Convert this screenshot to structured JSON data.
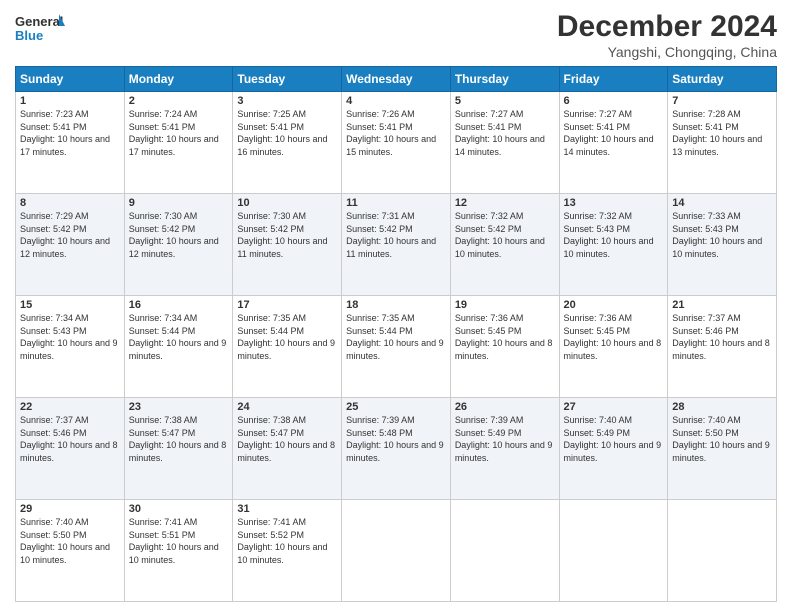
{
  "header": {
    "logo_line1": "General",
    "logo_line2": "Blue",
    "title": "December 2024",
    "subtitle": "Yangshi, Chongqing, China"
  },
  "columns": [
    "Sunday",
    "Monday",
    "Tuesday",
    "Wednesday",
    "Thursday",
    "Friday",
    "Saturday"
  ],
  "weeks": [
    [
      {
        "day": "1",
        "sunrise": "7:23 AM",
        "sunset": "5:41 PM",
        "daylight": "10 hours and 17 minutes."
      },
      {
        "day": "2",
        "sunrise": "7:24 AM",
        "sunset": "5:41 PM",
        "daylight": "10 hours and 17 minutes."
      },
      {
        "day": "3",
        "sunrise": "7:25 AM",
        "sunset": "5:41 PM",
        "daylight": "10 hours and 16 minutes."
      },
      {
        "day": "4",
        "sunrise": "7:26 AM",
        "sunset": "5:41 PM",
        "daylight": "10 hours and 15 minutes."
      },
      {
        "day": "5",
        "sunrise": "7:27 AM",
        "sunset": "5:41 PM",
        "daylight": "10 hours and 14 minutes."
      },
      {
        "day": "6",
        "sunrise": "7:27 AM",
        "sunset": "5:41 PM",
        "daylight": "10 hours and 14 minutes."
      },
      {
        "day": "7",
        "sunrise": "7:28 AM",
        "sunset": "5:41 PM",
        "daylight": "10 hours and 13 minutes."
      }
    ],
    [
      {
        "day": "8",
        "sunrise": "7:29 AM",
        "sunset": "5:42 PM",
        "daylight": "10 hours and 12 minutes."
      },
      {
        "day": "9",
        "sunrise": "7:30 AM",
        "sunset": "5:42 PM",
        "daylight": "10 hours and 12 minutes."
      },
      {
        "day": "10",
        "sunrise": "7:30 AM",
        "sunset": "5:42 PM",
        "daylight": "10 hours and 11 minutes."
      },
      {
        "day": "11",
        "sunrise": "7:31 AM",
        "sunset": "5:42 PM",
        "daylight": "10 hours and 11 minutes."
      },
      {
        "day": "12",
        "sunrise": "7:32 AM",
        "sunset": "5:42 PM",
        "daylight": "10 hours and 10 minutes."
      },
      {
        "day": "13",
        "sunrise": "7:32 AM",
        "sunset": "5:43 PM",
        "daylight": "10 hours and 10 minutes."
      },
      {
        "day": "14",
        "sunrise": "7:33 AM",
        "sunset": "5:43 PM",
        "daylight": "10 hours and 10 minutes."
      }
    ],
    [
      {
        "day": "15",
        "sunrise": "7:34 AM",
        "sunset": "5:43 PM",
        "daylight": "10 hours and 9 minutes."
      },
      {
        "day": "16",
        "sunrise": "7:34 AM",
        "sunset": "5:44 PM",
        "daylight": "10 hours and 9 minutes."
      },
      {
        "day": "17",
        "sunrise": "7:35 AM",
        "sunset": "5:44 PM",
        "daylight": "10 hours and 9 minutes."
      },
      {
        "day": "18",
        "sunrise": "7:35 AM",
        "sunset": "5:44 PM",
        "daylight": "10 hours and 9 minutes."
      },
      {
        "day": "19",
        "sunrise": "7:36 AM",
        "sunset": "5:45 PM",
        "daylight": "10 hours and 8 minutes."
      },
      {
        "day": "20",
        "sunrise": "7:36 AM",
        "sunset": "5:45 PM",
        "daylight": "10 hours and 8 minutes."
      },
      {
        "day": "21",
        "sunrise": "7:37 AM",
        "sunset": "5:46 PM",
        "daylight": "10 hours and 8 minutes."
      }
    ],
    [
      {
        "day": "22",
        "sunrise": "7:37 AM",
        "sunset": "5:46 PM",
        "daylight": "10 hours and 8 minutes."
      },
      {
        "day": "23",
        "sunrise": "7:38 AM",
        "sunset": "5:47 PM",
        "daylight": "10 hours and 8 minutes."
      },
      {
        "day": "24",
        "sunrise": "7:38 AM",
        "sunset": "5:47 PM",
        "daylight": "10 hours and 8 minutes."
      },
      {
        "day": "25",
        "sunrise": "7:39 AM",
        "sunset": "5:48 PM",
        "daylight": "10 hours and 9 minutes."
      },
      {
        "day": "26",
        "sunrise": "7:39 AM",
        "sunset": "5:49 PM",
        "daylight": "10 hours and 9 minutes."
      },
      {
        "day": "27",
        "sunrise": "7:40 AM",
        "sunset": "5:49 PM",
        "daylight": "10 hours and 9 minutes."
      },
      {
        "day": "28",
        "sunrise": "7:40 AM",
        "sunset": "5:50 PM",
        "daylight": "10 hours and 9 minutes."
      }
    ],
    [
      {
        "day": "29",
        "sunrise": "7:40 AM",
        "sunset": "5:50 PM",
        "daylight": "10 hours and 10 minutes."
      },
      {
        "day": "30",
        "sunrise": "7:41 AM",
        "sunset": "5:51 PM",
        "daylight": "10 hours and 10 minutes."
      },
      {
        "day": "31",
        "sunrise": "7:41 AM",
        "sunset": "5:52 PM",
        "daylight": "10 hours and 10 minutes."
      },
      null,
      null,
      null,
      null
    ]
  ],
  "labels": {
    "sunrise": "Sunrise:",
    "sunset": "Sunset:",
    "daylight": "Daylight:"
  }
}
